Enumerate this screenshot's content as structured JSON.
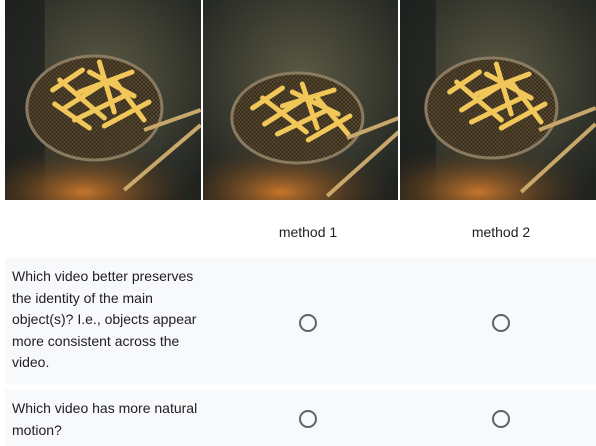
{
  "frames": [
    {
      "name": "video-frame-1"
    },
    {
      "name": "video-frame-2"
    },
    {
      "name": "video-frame-3"
    }
  ],
  "columns": [
    "method 1",
    "method 2"
  ],
  "questions": [
    {
      "text": "Which video better preserves the identity of the main object(s)? I.e., objects appear more consistent across the video."
    },
    {
      "text": "Which video has more natural motion?"
    }
  ],
  "colors": {
    "row_background": "#f8f9fa",
    "radio_border": "#5f6368",
    "fries": "#f2c75a"
  }
}
